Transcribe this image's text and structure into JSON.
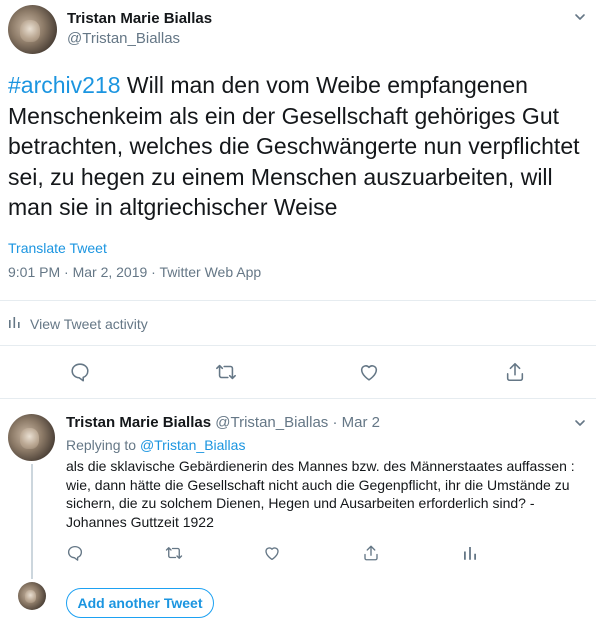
{
  "main_tweet": {
    "author_name": "Tristan Marie Biallas",
    "author_handle": "@Tristan_Biallas",
    "hashtag": "#archiv218",
    "text": " Will man den vom Weibe empfangenen Menschenkeim als ein der Gesellschaft gehöriges Gut betrachten, welches die Geschwängerte nun verpflichtet sei, zu hegen zu einem Menschen auszuarbeiten, will man sie in altgriechischer Weise",
    "translate_label": "Translate Tweet",
    "timestamp": "9:01 PM · Mar 2, 2019 · Twitter Web App",
    "activity_label": "View Tweet activity",
    "icons": [
      "chevron-down-icon",
      "reply-icon",
      "retweet-icon",
      "like-icon",
      "share-icon",
      "activity-icon"
    ]
  },
  "reply_tweet": {
    "author_name": "Tristan Marie Biallas",
    "author_handle_date": "@Tristan_Biallas · Mar 2",
    "replying_prefix": "Replying to ",
    "replying_handle": "@Tristan_Biallas",
    "text": "als die sklavische Gebärdienerin des Mannes bzw. des Männerstaates auffassen : wie, dann hätte die Gesellschaft nicht auch die Gegenpflicht, ihr die Umstände zu sichern, die zu solchem Dienen, Hegen und Ausarbeiten erforderlich sind? - Johannes Guttzeit 1922"
  },
  "compose": {
    "add_tweet_label": "Add another Tweet"
  },
  "colors": {
    "accent": "#1da1f2",
    "link": "#1b95e0",
    "muted": "#657786",
    "text": "#14171a",
    "border": "#e6ecf0"
  }
}
